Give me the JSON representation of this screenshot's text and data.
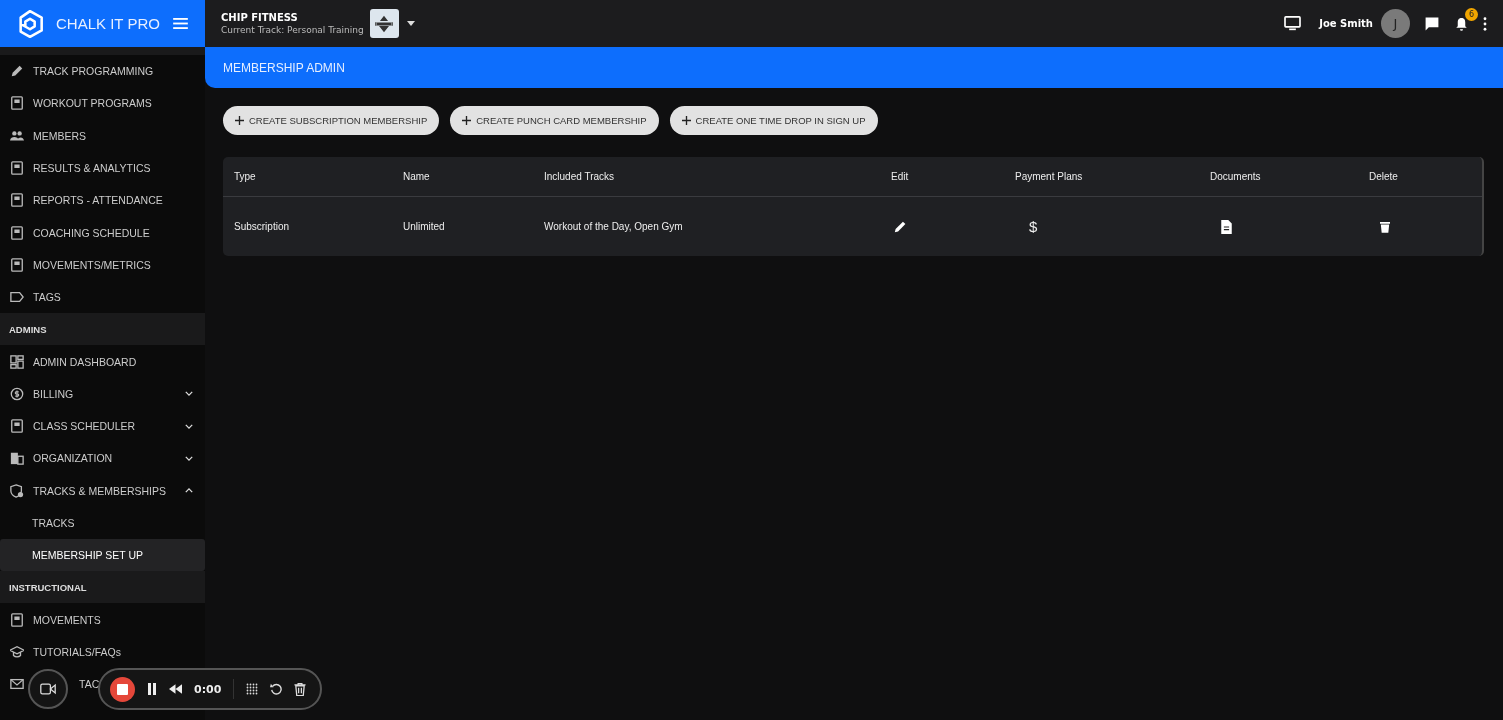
{
  "app": {
    "logo_text": "CHALK IT PRO"
  },
  "topbar": {
    "gym": "CHIP FITNESS",
    "track": "Current Track: Personal Training",
    "user": "Joe Smith",
    "avatar_initial": "J",
    "notifications": "6"
  },
  "sidebar": {
    "sections": [
      {
        "items": [
          {
            "label": "TRACK PROGRAMMING",
            "selected": false
          },
          {
            "label": "WORKOUT PROGRAMS",
            "selected": false
          },
          {
            "label": "MEMBERS",
            "selected": false
          },
          {
            "label": "RESULTS & ANALYTICS",
            "selected": false
          },
          {
            "label": "REPORTS - ATTENDANCE",
            "selected": false
          },
          {
            "label": "COACHING SCHEDULE",
            "selected": false
          },
          {
            "label": "MOVEMENTS/METRICS",
            "selected": false
          },
          {
            "label": "TAGS",
            "selected": false
          }
        ]
      },
      {
        "title": "ADMINS",
        "items": [
          {
            "label": "ADMIN DASHBOARD",
            "selected": false
          },
          {
            "label": "BILLING",
            "selected": false,
            "expanded": false
          },
          {
            "label": "CLASS SCHEDULER",
            "selected": false,
            "expanded": false
          },
          {
            "label": "ORGANIZATION",
            "selected": false,
            "expanded": false
          },
          {
            "label": "TRACKS & MEMBERSHIPS",
            "selected": false,
            "expanded": true,
            "children": [
              {
                "label": "TRACKS",
                "selected": false
              },
              {
                "label": "MEMBERSHIP SET UP",
                "selected": true
              }
            ]
          }
        ]
      },
      {
        "title": "INSTRUCTIONAL",
        "items": [
          {
            "label": "MOVEMENTS",
            "selected": false
          },
          {
            "label": "TUTORIALS/FAQs",
            "selected": false
          },
          {
            "label": "TAC",
            "selected": false
          }
        ]
      }
    ]
  },
  "page": {
    "title": "MEMBERSHIP ADMIN",
    "buttons": [
      "CREATE SUBSCRIPTION MEMBERSHIP",
      "CREATE PUNCH CARD MEMBERSHIP",
      "CREATE ONE TIME DROP IN SIGN UP"
    ],
    "table": {
      "columns": [
        "Type",
        "Name",
        "Included Tracks",
        "Edit",
        "Payment Plans",
        "Documents",
        "Delete"
      ],
      "rows": [
        {
          "type": "Subscription",
          "name": "Unlimited",
          "tracks": "Workout of the Day, Open Gym",
          "payment": "$"
        }
      ]
    }
  },
  "recorder": {
    "time": "0:00"
  }
}
